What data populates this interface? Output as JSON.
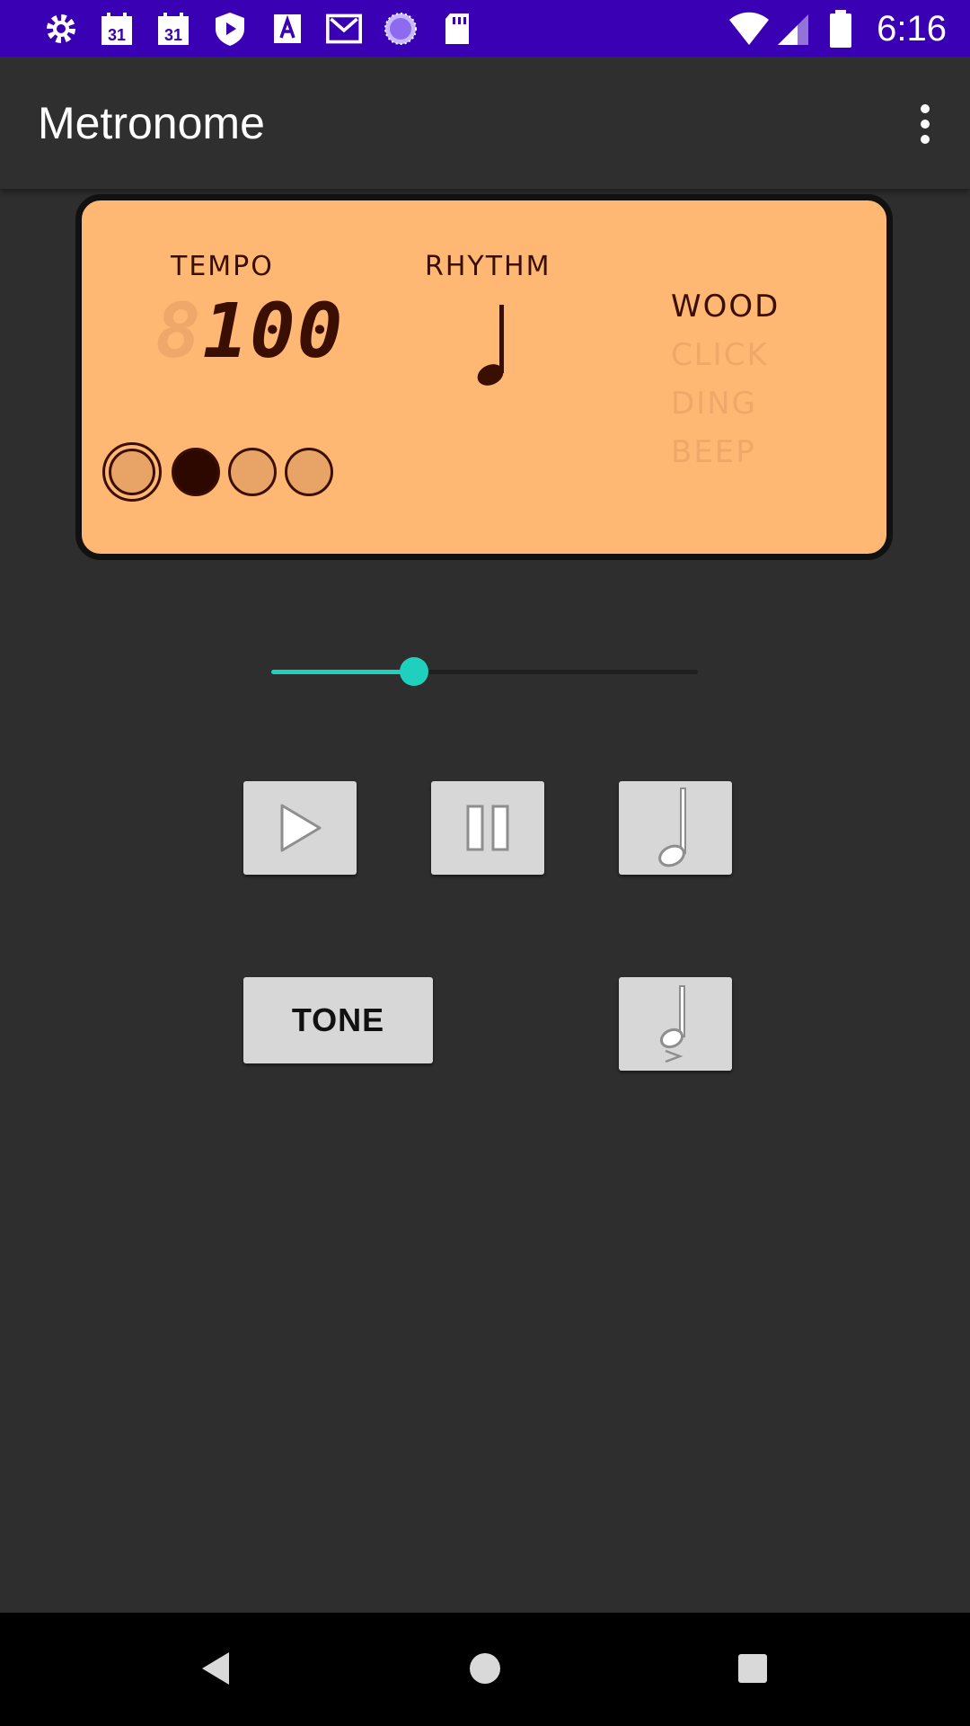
{
  "status_bar": {
    "time": "6:16",
    "calendar_day_1": "31",
    "calendar_day_2": "31",
    "icons": [
      "gear-icon",
      "calendar-icon",
      "calendar-icon",
      "shield-play-icon",
      "font-a-icon",
      "gmail-icon",
      "loading-circle-icon",
      "sd-card-icon",
      "wifi-icon",
      "signal-icon",
      "battery-icon"
    ]
  },
  "app_bar": {
    "title": "Metronome",
    "menu_icon": "more-vert-icon"
  },
  "display": {
    "tempo_label": "TEMPO",
    "tempo_value": "100",
    "rhythm_label": "RHYTHM",
    "rhythm_symbol": "quarter-note-icon",
    "sounds": [
      "WOOD",
      "CLICK",
      "DING",
      "BEEP"
    ],
    "selected_sound": "WOOD",
    "beats_total": 4,
    "active_beat": 2,
    "colors": {
      "panel": "#ffb774",
      "ink": "#3a0f02",
      "dim": "#f0a86a"
    }
  },
  "tempo_slider": {
    "value_fraction": 0.34,
    "accent": "#1fd0bf"
  },
  "controls": {
    "play_icon": "play-icon",
    "pause_icon": "pause-icon",
    "half_note_icon": "half-note-icon",
    "tone_label": "TONE",
    "accent_note_icon": "accent-note-icon"
  },
  "nav_bar": {
    "icons": [
      "back-icon",
      "home-icon",
      "recents-icon"
    ]
  }
}
